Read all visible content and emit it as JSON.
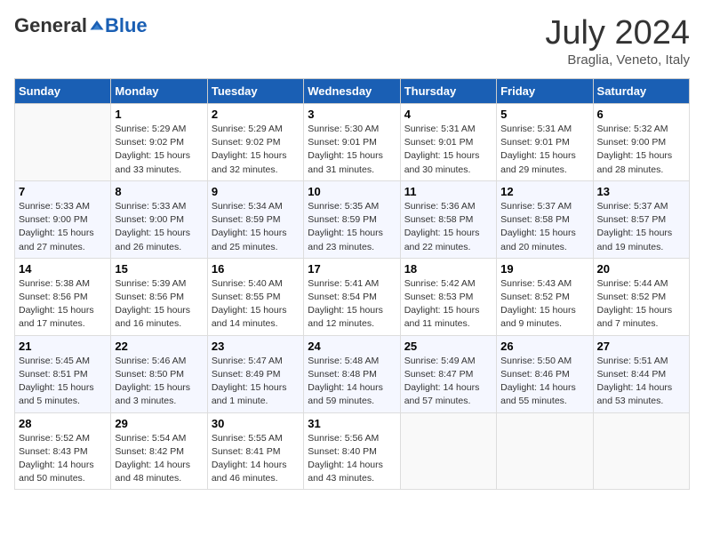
{
  "header": {
    "logo_general": "General",
    "logo_blue": "Blue",
    "month_year": "July 2024",
    "location": "Braglia, Veneto, Italy"
  },
  "days_of_week": [
    "Sunday",
    "Monday",
    "Tuesday",
    "Wednesday",
    "Thursday",
    "Friday",
    "Saturday"
  ],
  "weeks": [
    [
      {
        "day": "",
        "info": ""
      },
      {
        "day": "1",
        "info": "Sunrise: 5:29 AM\nSunset: 9:02 PM\nDaylight: 15 hours\nand 33 minutes."
      },
      {
        "day": "2",
        "info": "Sunrise: 5:29 AM\nSunset: 9:02 PM\nDaylight: 15 hours\nand 32 minutes."
      },
      {
        "day": "3",
        "info": "Sunrise: 5:30 AM\nSunset: 9:01 PM\nDaylight: 15 hours\nand 31 minutes."
      },
      {
        "day": "4",
        "info": "Sunrise: 5:31 AM\nSunset: 9:01 PM\nDaylight: 15 hours\nand 30 minutes."
      },
      {
        "day": "5",
        "info": "Sunrise: 5:31 AM\nSunset: 9:01 PM\nDaylight: 15 hours\nand 29 minutes."
      },
      {
        "day": "6",
        "info": "Sunrise: 5:32 AM\nSunset: 9:00 PM\nDaylight: 15 hours\nand 28 minutes."
      }
    ],
    [
      {
        "day": "7",
        "info": "Sunrise: 5:33 AM\nSunset: 9:00 PM\nDaylight: 15 hours\nand 27 minutes."
      },
      {
        "day": "8",
        "info": "Sunrise: 5:33 AM\nSunset: 9:00 PM\nDaylight: 15 hours\nand 26 minutes."
      },
      {
        "day": "9",
        "info": "Sunrise: 5:34 AM\nSunset: 8:59 PM\nDaylight: 15 hours\nand 25 minutes."
      },
      {
        "day": "10",
        "info": "Sunrise: 5:35 AM\nSunset: 8:59 PM\nDaylight: 15 hours\nand 23 minutes."
      },
      {
        "day": "11",
        "info": "Sunrise: 5:36 AM\nSunset: 8:58 PM\nDaylight: 15 hours\nand 22 minutes."
      },
      {
        "day": "12",
        "info": "Sunrise: 5:37 AM\nSunset: 8:58 PM\nDaylight: 15 hours\nand 20 minutes."
      },
      {
        "day": "13",
        "info": "Sunrise: 5:37 AM\nSunset: 8:57 PM\nDaylight: 15 hours\nand 19 minutes."
      }
    ],
    [
      {
        "day": "14",
        "info": "Sunrise: 5:38 AM\nSunset: 8:56 PM\nDaylight: 15 hours\nand 17 minutes."
      },
      {
        "day": "15",
        "info": "Sunrise: 5:39 AM\nSunset: 8:56 PM\nDaylight: 15 hours\nand 16 minutes."
      },
      {
        "day": "16",
        "info": "Sunrise: 5:40 AM\nSunset: 8:55 PM\nDaylight: 15 hours\nand 14 minutes."
      },
      {
        "day": "17",
        "info": "Sunrise: 5:41 AM\nSunset: 8:54 PM\nDaylight: 15 hours\nand 12 minutes."
      },
      {
        "day": "18",
        "info": "Sunrise: 5:42 AM\nSunset: 8:53 PM\nDaylight: 15 hours\nand 11 minutes."
      },
      {
        "day": "19",
        "info": "Sunrise: 5:43 AM\nSunset: 8:52 PM\nDaylight: 15 hours\nand 9 minutes."
      },
      {
        "day": "20",
        "info": "Sunrise: 5:44 AM\nSunset: 8:52 PM\nDaylight: 15 hours\nand 7 minutes."
      }
    ],
    [
      {
        "day": "21",
        "info": "Sunrise: 5:45 AM\nSunset: 8:51 PM\nDaylight: 15 hours\nand 5 minutes."
      },
      {
        "day": "22",
        "info": "Sunrise: 5:46 AM\nSunset: 8:50 PM\nDaylight: 15 hours\nand 3 minutes."
      },
      {
        "day": "23",
        "info": "Sunrise: 5:47 AM\nSunset: 8:49 PM\nDaylight: 15 hours\nand 1 minute."
      },
      {
        "day": "24",
        "info": "Sunrise: 5:48 AM\nSunset: 8:48 PM\nDaylight: 14 hours\nand 59 minutes."
      },
      {
        "day": "25",
        "info": "Sunrise: 5:49 AM\nSunset: 8:47 PM\nDaylight: 14 hours\nand 57 minutes."
      },
      {
        "day": "26",
        "info": "Sunrise: 5:50 AM\nSunset: 8:46 PM\nDaylight: 14 hours\nand 55 minutes."
      },
      {
        "day": "27",
        "info": "Sunrise: 5:51 AM\nSunset: 8:44 PM\nDaylight: 14 hours\nand 53 minutes."
      }
    ],
    [
      {
        "day": "28",
        "info": "Sunrise: 5:52 AM\nSunset: 8:43 PM\nDaylight: 14 hours\nand 50 minutes."
      },
      {
        "day": "29",
        "info": "Sunrise: 5:54 AM\nSunset: 8:42 PM\nDaylight: 14 hours\nand 48 minutes."
      },
      {
        "day": "30",
        "info": "Sunrise: 5:55 AM\nSunset: 8:41 PM\nDaylight: 14 hours\nand 46 minutes."
      },
      {
        "day": "31",
        "info": "Sunrise: 5:56 AM\nSunset: 8:40 PM\nDaylight: 14 hours\nand 43 minutes."
      },
      {
        "day": "",
        "info": ""
      },
      {
        "day": "",
        "info": ""
      },
      {
        "day": "",
        "info": ""
      }
    ]
  ]
}
